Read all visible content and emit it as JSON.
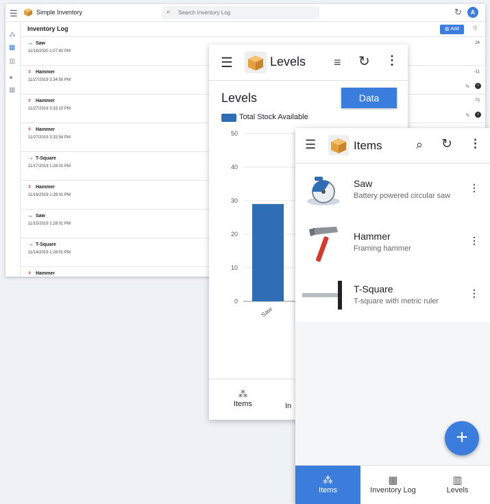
{
  "desktop": {
    "app_title": "Simple Inventory",
    "search_placeholder": "Search Inventory Log",
    "avatar_initial": "A",
    "page_title": "Inventory Log",
    "add_label": "Add",
    "rows": [
      {
        "name": "Saw",
        "date": "11/16/2020 1:07:40 PM",
        "qty": "24"
      },
      {
        "name": "Hammer",
        "date": "11/27/2019 3:34:50 PM",
        "qty": "-11"
      },
      {
        "name": "Hammer",
        "date": "11/27/2019 3:33:10 PM",
        "qty": "72"
      },
      {
        "name": "Hammer",
        "date": "11/27/2019 3:32:54 PM",
        "qty": ""
      },
      {
        "name": "T-Square",
        "date": "11/17/2019 1:28:01 PM",
        "qty": ""
      },
      {
        "name": "Hammer",
        "date": "11/16/2019 1:28:01 PM",
        "qty": ""
      },
      {
        "name": "Saw",
        "date": "11/15/2019 1:28:01 PM",
        "qty": ""
      },
      {
        "name": "T-Square",
        "date": "11/14/2019 1:28:01 PM",
        "qty": ""
      },
      {
        "name": "Hammer",
        "date": "",
        "qty": ""
      }
    ]
  },
  "levels": {
    "header_title": "Levels",
    "chart_title": "Levels",
    "data_button": "Data",
    "tabs": {
      "items": "Items",
      "inventory_partial": "In"
    }
  },
  "items_screen": {
    "header_title": "Items",
    "items": [
      {
        "name": "Saw",
        "description": "Battery powered circular saw"
      },
      {
        "name": "Hammer",
        "description": "Framing hammer"
      },
      {
        "name": "T-Square",
        "description": "T-square with metric ruler"
      }
    ],
    "fab_label": "+",
    "tabs": [
      {
        "label": "Items",
        "icon": "boxes-icon",
        "active": true
      },
      {
        "label": "Inventory Log",
        "icon": "warehouse-icon",
        "active": false
      },
      {
        "label": "Levels",
        "icon": "bar-chart-icon",
        "active": false
      }
    ]
  },
  "colors": {
    "accent": "#3b7ddd",
    "bar": "#2f6db5"
  },
  "chart_data": {
    "type": "bar",
    "categories": [
      "Saw"
    ],
    "series": [
      {
        "name": "Total Stock Available",
        "values": [
          29
        ]
      }
    ],
    "ylim": [
      0,
      50
    ],
    "yticks": [
      0,
      10,
      20,
      30,
      40,
      50
    ],
    "title": "Levels",
    "legend": "top-left"
  }
}
